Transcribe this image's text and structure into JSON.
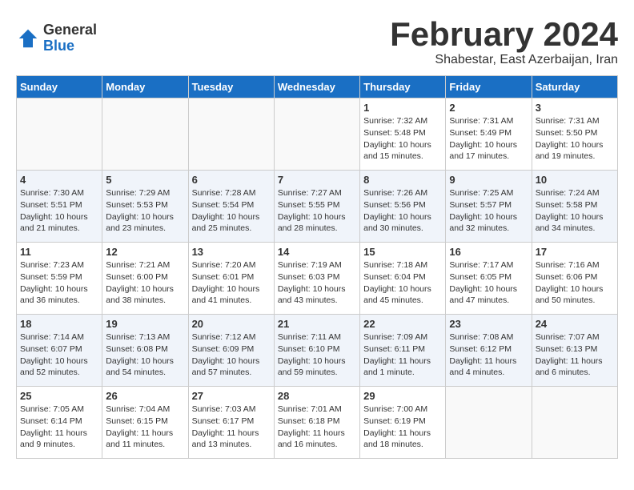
{
  "header": {
    "logo_general": "General",
    "logo_blue": "Blue",
    "month_title": "February 2024",
    "location": "Shabestar, East Azerbaijan, Iran"
  },
  "weekdays": [
    "Sunday",
    "Monday",
    "Tuesday",
    "Wednesday",
    "Thursday",
    "Friday",
    "Saturday"
  ],
  "weeks": [
    [
      {
        "day": "",
        "info": ""
      },
      {
        "day": "",
        "info": ""
      },
      {
        "day": "",
        "info": ""
      },
      {
        "day": "",
        "info": ""
      },
      {
        "day": "1",
        "info": "Sunrise: 7:32 AM\nSunset: 5:48 PM\nDaylight: 10 hours\nand 15 minutes."
      },
      {
        "day": "2",
        "info": "Sunrise: 7:31 AM\nSunset: 5:49 PM\nDaylight: 10 hours\nand 17 minutes."
      },
      {
        "day": "3",
        "info": "Sunrise: 7:31 AM\nSunset: 5:50 PM\nDaylight: 10 hours\nand 19 minutes."
      }
    ],
    [
      {
        "day": "4",
        "info": "Sunrise: 7:30 AM\nSunset: 5:51 PM\nDaylight: 10 hours\nand 21 minutes."
      },
      {
        "day": "5",
        "info": "Sunrise: 7:29 AM\nSunset: 5:53 PM\nDaylight: 10 hours\nand 23 minutes."
      },
      {
        "day": "6",
        "info": "Sunrise: 7:28 AM\nSunset: 5:54 PM\nDaylight: 10 hours\nand 25 minutes."
      },
      {
        "day": "7",
        "info": "Sunrise: 7:27 AM\nSunset: 5:55 PM\nDaylight: 10 hours\nand 28 minutes."
      },
      {
        "day": "8",
        "info": "Sunrise: 7:26 AM\nSunset: 5:56 PM\nDaylight: 10 hours\nand 30 minutes."
      },
      {
        "day": "9",
        "info": "Sunrise: 7:25 AM\nSunset: 5:57 PM\nDaylight: 10 hours\nand 32 minutes."
      },
      {
        "day": "10",
        "info": "Sunrise: 7:24 AM\nSunset: 5:58 PM\nDaylight: 10 hours\nand 34 minutes."
      }
    ],
    [
      {
        "day": "11",
        "info": "Sunrise: 7:23 AM\nSunset: 5:59 PM\nDaylight: 10 hours\nand 36 minutes."
      },
      {
        "day": "12",
        "info": "Sunrise: 7:21 AM\nSunset: 6:00 PM\nDaylight: 10 hours\nand 38 minutes."
      },
      {
        "day": "13",
        "info": "Sunrise: 7:20 AM\nSunset: 6:01 PM\nDaylight: 10 hours\nand 41 minutes."
      },
      {
        "day": "14",
        "info": "Sunrise: 7:19 AM\nSunset: 6:03 PM\nDaylight: 10 hours\nand 43 minutes."
      },
      {
        "day": "15",
        "info": "Sunrise: 7:18 AM\nSunset: 6:04 PM\nDaylight: 10 hours\nand 45 minutes."
      },
      {
        "day": "16",
        "info": "Sunrise: 7:17 AM\nSunset: 6:05 PM\nDaylight: 10 hours\nand 47 minutes."
      },
      {
        "day": "17",
        "info": "Sunrise: 7:16 AM\nSunset: 6:06 PM\nDaylight: 10 hours\nand 50 minutes."
      }
    ],
    [
      {
        "day": "18",
        "info": "Sunrise: 7:14 AM\nSunset: 6:07 PM\nDaylight: 10 hours\nand 52 minutes."
      },
      {
        "day": "19",
        "info": "Sunrise: 7:13 AM\nSunset: 6:08 PM\nDaylight: 10 hours\nand 54 minutes."
      },
      {
        "day": "20",
        "info": "Sunrise: 7:12 AM\nSunset: 6:09 PM\nDaylight: 10 hours\nand 57 minutes."
      },
      {
        "day": "21",
        "info": "Sunrise: 7:11 AM\nSunset: 6:10 PM\nDaylight: 10 hours\nand 59 minutes."
      },
      {
        "day": "22",
        "info": "Sunrise: 7:09 AM\nSunset: 6:11 PM\nDaylight: 11 hours\nand 1 minute."
      },
      {
        "day": "23",
        "info": "Sunrise: 7:08 AM\nSunset: 6:12 PM\nDaylight: 11 hours\nand 4 minutes."
      },
      {
        "day": "24",
        "info": "Sunrise: 7:07 AM\nSunset: 6:13 PM\nDaylight: 11 hours\nand 6 minutes."
      }
    ],
    [
      {
        "day": "25",
        "info": "Sunrise: 7:05 AM\nSunset: 6:14 PM\nDaylight: 11 hours\nand 9 minutes."
      },
      {
        "day": "26",
        "info": "Sunrise: 7:04 AM\nSunset: 6:15 PM\nDaylight: 11 hours\nand 11 minutes."
      },
      {
        "day": "27",
        "info": "Sunrise: 7:03 AM\nSunset: 6:17 PM\nDaylight: 11 hours\nand 13 minutes."
      },
      {
        "day": "28",
        "info": "Sunrise: 7:01 AM\nSunset: 6:18 PM\nDaylight: 11 hours\nand 16 minutes."
      },
      {
        "day": "29",
        "info": "Sunrise: 7:00 AM\nSunset: 6:19 PM\nDaylight: 11 hours\nand 18 minutes."
      },
      {
        "day": "",
        "info": ""
      },
      {
        "day": "",
        "info": ""
      }
    ]
  ]
}
